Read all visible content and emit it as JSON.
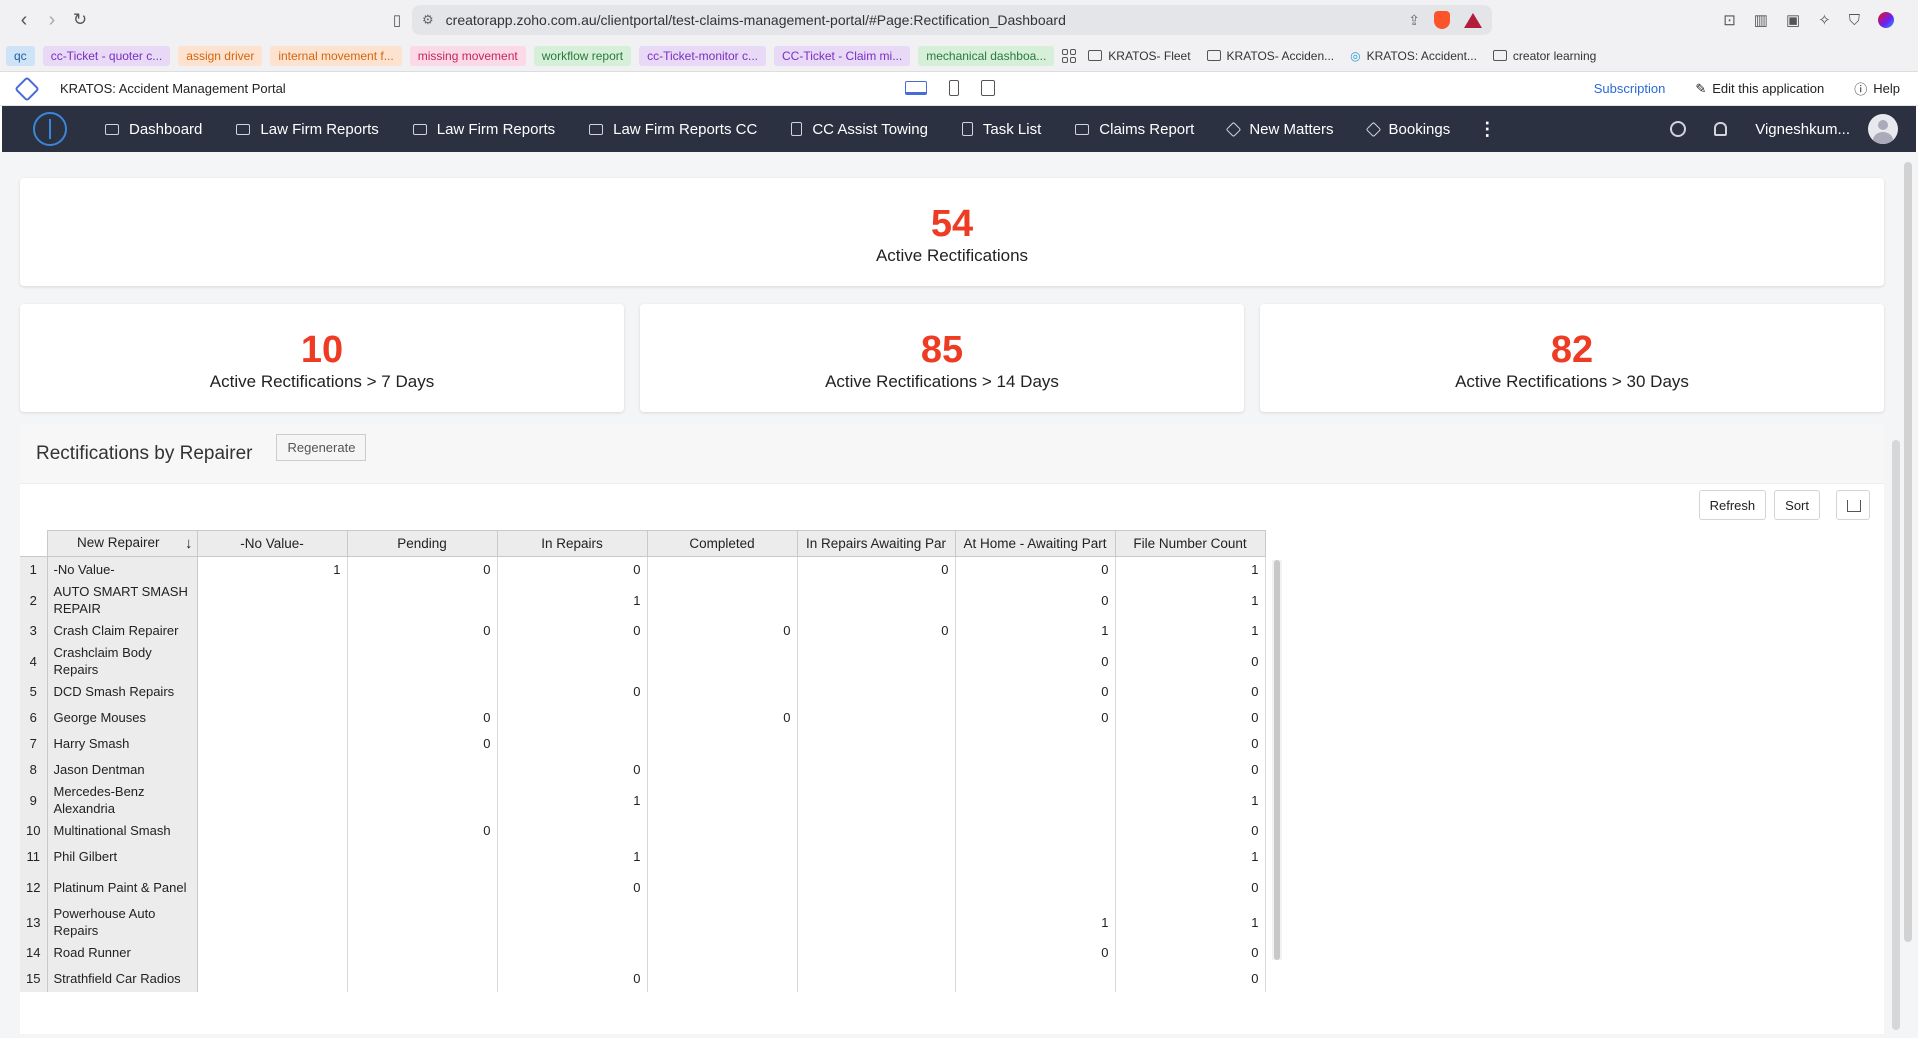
{
  "browser": {
    "url": "creatorapp.zoho.com.au/clientportal/test-claims-management-portal/#Page:Rectification_Dashboard",
    "bookmarks": [
      {
        "label": "qc",
        "bg": "#cfe3f7",
        "fg": "#1d5fa8"
      },
      {
        "label": "cc-Ticket - quoter c...",
        "bg": "#e8d9f7",
        "fg": "#7a2fc0"
      },
      {
        "label": "assign driver",
        "bg": "#fde3cf",
        "fg": "#d3650f"
      },
      {
        "label": "internal movement f...",
        "bg": "#fde3cf",
        "fg": "#d3650f"
      },
      {
        "label": "missing movement",
        "bg": "#fbd9e6",
        "fg": "#c4265e"
      },
      {
        "label": "workflow report",
        "bg": "#d6efd9",
        "fg": "#2b7a3a"
      },
      {
        "label": "cc-Ticket-monitor c...",
        "bg": "#e8d9f7",
        "fg": "#7a2fc0"
      },
      {
        "label": "CC-Ticket - Claim mi...",
        "bg": "#e8d9f7",
        "fg": "#7a2fc0"
      },
      {
        "label": "mechanical dashboa...",
        "bg": "#d6efd9",
        "fg": "#2b7a3a"
      }
    ],
    "folders": [
      "KRATOS- Fleet",
      "KRATOS- Acciden...",
      "KRATOS: Accident...",
      "creator learning"
    ]
  },
  "app": {
    "title": "KRATOS: Accident Management Portal",
    "subscription": "Subscription",
    "edit": "Edit this application",
    "help": "Help"
  },
  "nav": {
    "items": [
      "Dashboard",
      "Law Firm Reports",
      "Law Firm Reports",
      "Law Firm Reports CC",
      "CC Assist Towing",
      "Task List",
      "Claims Report",
      "New Matters",
      "Bookings"
    ],
    "user": "Vigneshkum..."
  },
  "cards": {
    "total": {
      "value": "54",
      "label": "Active Rectifications"
    },
    "d7": {
      "value": "10",
      "label": "Active Rectifications > 7 Days"
    },
    "d14": {
      "value": "85",
      "label": "Active Rectifications > 14 Days"
    },
    "d30": {
      "value": "82",
      "label": "Active Rectifications > 30 Days"
    }
  },
  "report": {
    "title": "Rectifications by Repairer",
    "regenerate": "Regenerate",
    "refresh": "Refresh",
    "sort": "Sort",
    "columns": [
      "New Repairer",
      "-No Value-",
      "Pending",
      "In Repairs",
      "Completed",
      "In Repairs Awaiting Par",
      "At Home - Awaiting Part",
      "File Number Count"
    ],
    "rows": [
      {
        "n": "1",
        "name": "-No Value-",
        "vals": [
          "1",
          "0",
          "0",
          "",
          "0",
          "0",
          "1"
        ]
      },
      {
        "n": "2",
        "name": "AUTO SMART SMASH REPAIR",
        "vals": [
          "",
          "",
          "1",
          "",
          "",
          "0",
          "1"
        ]
      },
      {
        "n": "3",
        "name": "Crash Claim Repairer",
        "vals": [
          "",
          "0",
          "0",
          "0",
          "0",
          "1",
          "1"
        ]
      },
      {
        "n": "4",
        "name": "Crashclaim Body Repairs",
        "vals": [
          "",
          "",
          "",
          "",
          "",
          "0",
          "0"
        ]
      },
      {
        "n": "5",
        "name": "DCD Smash Repairs",
        "vals": [
          "",
          "",
          "0",
          "",
          "",
          "0",
          "0"
        ]
      },
      {
        "n": "6",
        "name": "George Mouses",
        "vals": [
          "",
          "0",
          "",
          "0",
          "",
          "0",
          "0"
        ]
      },
      {
        "n": "7",
        "name": "Harry Smash",
        "vals": [
          "",
          "0",
          "",
          "",
          "",
          "",
          "0"
        ]
      },
      {
        "n": "8",
        "name": "Jason Dentman",
        "vals": [
          "",
          "",
          "0",
          "",
          "",
          "",
          "0"
        ]
      },
      {
        "n": "9",
        "name": "Mercedes-Benz Alexandria",
        "vals": [
          "",
          "",
          "1",
          "",
          "",
          "",
          "1"
        ]
      },
      {
        "n": "10",
        "name": "Multinational Smash",
        "vals": [
          "",
          "0",
          "",
          "",
          "",
          "",
          "0"
        ]
      },
      {
        "n": "11",
        "name": "Phil Gilbert",
        "vals": [
          "",
          "",
          "1",
          "",
          "",
          "",
          "1"
        ]
      },
      {
        "n": "12",
        "name": "Platinum Paint & Panel",
        "vals": [
          "",
          "",
          "0",
          "",
          "",
          "",
          "0"
        ]
      },
      {
        "n": "13",
        "name": "Powerhouse Auto Repairs",
        "vals": [
          "",
          "",
          "",
          "",
          "",
          "1",
          "1"
        ]
      },
      {
        "n": "14",
        "name": "Road Runner",
        "vals": [
          "",
          "",
          "",
          "",
          "",
          "0",
          "0"
        ]
      },
      {
        "n": "15",
        "name": "Strathfield Car Radios",
        "vals": [
          "",
          "",
          "0",
          "",
          "",
          "",
          "0"
        ]
      }
    ]
  }
}
